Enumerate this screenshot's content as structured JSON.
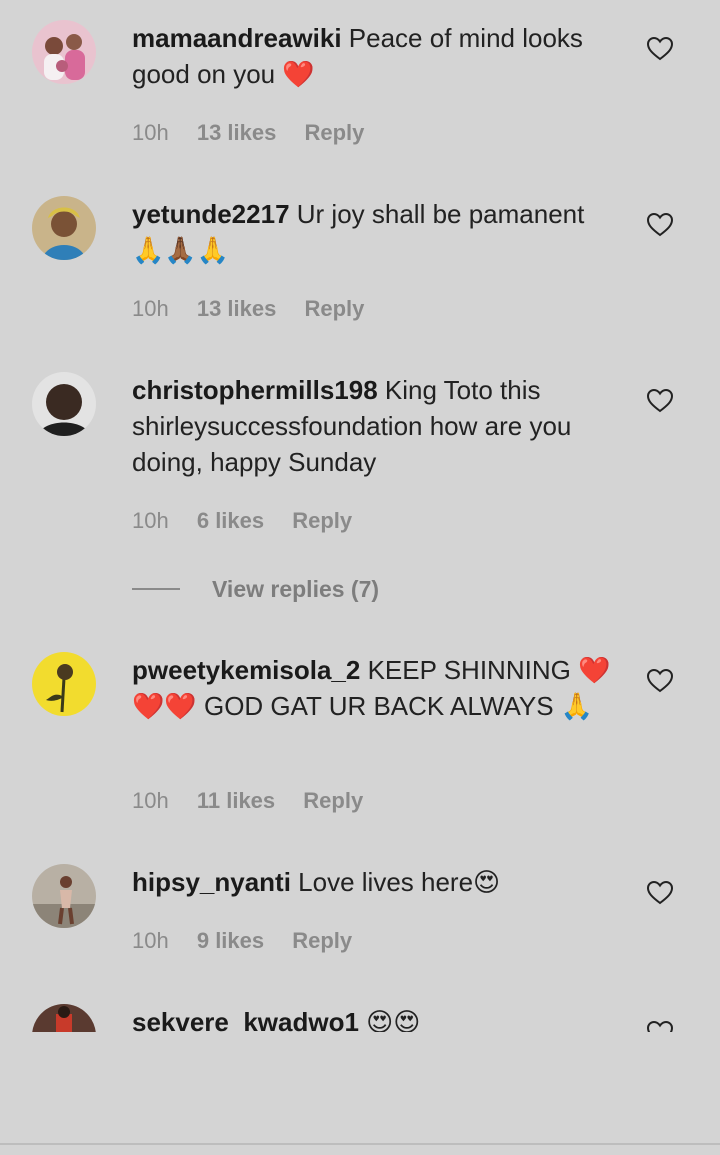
{
  "comments": [
    {
      "username": "mamaandreawiki",
      "text": "Peace of mind looks good on you ❤️",
      "time": "10h",
      "likes": "13 likes",
      "reply": "Reply"
    },
    {
      "username": "yetunde2217",
      "text": "Ur joy shall be pamanent 🙏🙏🏾🙏",
      "time": "10h",
      "likes": "13 likes",
      "reply": "Reply"
    },
    {
      "username": "christophermills198",
      "text": "King Toto this shirleysuccessfoundation how are you doing, happy Sunday",
      "time": "10h",
      "likes": "6 likes",
      "reply": "Reply"
    },
    {
      "username": "pweetykemisola_2",
      "text": "KEEP SHINNING ❤️❤️❤️ GOD GAT UR BACK ALWAYS 🙏",
      "time": "10h",
      "likes": "11 likes",
      "reply": "Reply"
    },
    {
      "username": "hipsy_nyanti",
      "text": "Love lives here😍",
      "time": "10h",
      "likes": "9 likes",
      "reply": "Reply"
    },
    {
      "username": "sekvere_kwadwo1",
      "text": "😍😍"
    }
  ],
  "view_replies": "View replies (7)",
  "icons": {
    "like": "heart-outline-icon"
  },
  "colors": {
    "background": "#d4d4d4",
    "meta_text": "#8a8a8a",
    "emoji_heart": "#c8102e"
  }
}
